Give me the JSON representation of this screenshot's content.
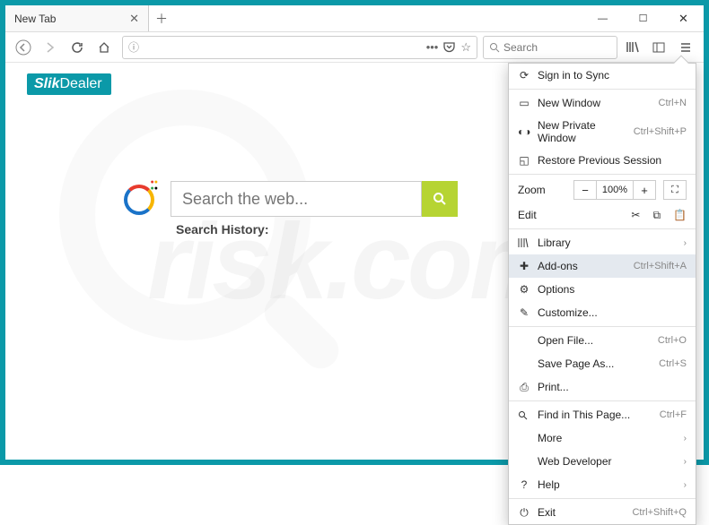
{
  "window": {
    "tab_title": "New Tab",
    "min": "—",
    "max": "☐",
    "close": "✕"
  },
  "toolbar": {
    "search_placeholder": "Search"
  },
  "page": {
    "logo_left": "Slik",
    "logo_right": "Dealer",
    "search_placeholder": "Search the web...",
    "history_label": "Search History:"
  },
  "menu": {
    "sign_in": "Sign in to Sync",
    "new_window": {
      "label": "New Window",
      "shortcut": "Ctrl+N"
    },
    "new_private": {
      "label": "New Private Window",
      "shortcut": "Ctrl+Shift+P"
    },
    "restore": "Restore Previous Session",
    "zoom_label": "Zoom",
    "zoom_pct": "100%",
    "edit_label": "Edit",
    "library": "Library",
    "addons": {
      "label": "Add-ons",
      "shortcut": "Ctrl+Shift+A"
    },
    "options": "Options",
    "customize": "Customize...",
    "open_file": {
      "label": "Open File...",
      "shortcut": "Ctrl+O"
    },
    "save_as": {
      "label": "Save Page As...",
      "shortcut": "Ctrl+S"
    },
    "print": "Print...",
    "find": {
      "label": "Find in This Page...",
      "shortcut": "Ctrl+F"
    },
    "more": "More",
    "webdev": "Web Developer",
    "help": "Help",
    "exit": {
      "label": "Exit",
      "shortcut": "Ctrl+Shift+Q"
    }
  }
}
